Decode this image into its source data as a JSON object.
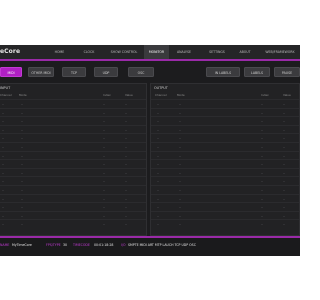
{
  "app": {
    "title": "eCore"
  },
  "nav": {
    "items": [
      {
        "label": "HOME"
      },
      {
        "label": "CLOCK"
      },
      {
        "label": "SHOW CONTROL"
      },
      {
        "label": "MONITOR"
      },
      {
        "label": "ANALYSE"
      },
      {
        "label": "SETTINGS"
      },
      {
        "label": "ABOUT"
      },
      {
        "label": "WEB/FRAMEWORK"
      }
    ],
    "active_index": 3
  },
  "toolbar": {
    "left_buttons": [
      {
        "label": "MIDI"
      },
      {
        "label": "OTHER MIDI"
      },
      {
        "label": "TCP"
      },
      {
        "label": "UDP"
      },
      {
        "label": "OSC"
      }
    ],
    "right_buttons": [
      {
        "label": "IN LABELS"
      },
      {
        "label": "LABELS"
      },
      {
        "label": "PAUSE"
      }
    ]
  },
  "input_panel": {
    "title": "INPUT",
    "columns": [
      "Channel",
      "Mode",
      "Index",
      "Value"
    ],
    "rows": [
      [
        "--",
        "--",
        "--",
        "--"
      ],
      [
        "--",
        "--",
        "--",
        "--"
      ],
      [
        "--",
        "--",
        "--",
        "--"
      ],
      [
        "--",
        "--",
        "--",
        "--"
      ],
      [
        "--",
        "--",
        "--",
        "--"
      ],
      [
        "--",
        "--",
        "--",
        "--"
      ],
      [
        "--",
        "--",
        "--",
        "--"
      ],
      [
        "--",
        "--",
        "--",
        "--"
      ],
      [
        "--",
        "--",
        "--",
        "--"
      ],
      [
        "--",
        "--",
        "--",
        "--"
      ],
      [
        "--",
        "--",
        "--",
        "--"
      ],
      [
        "--",
        "--",
        "--",
        "--"
      ],
      [
        "--",
        "--",
        "--",
        "--"
      ],
      [
        "--",
        "--",
        "--",
        "--"
      ],
      [
        "--",
        "--",
        "--",
        "--"
      ]
    ]
  },
  "output_panel": {
    "title": "OUTPUT",
    "columns": [
      "Channel",
      "Mode",
      "Index",
      "Value"
    ],
    "rows": [
      [
        "--",
        "--",
        "--",
        "--"
      ],
      [
        "--",
        "--",
        "--",
        "--"
      ],
      [
        "--",
        "--",
        "--",
        "--"
      ],
      [
        "--",
        "--",
        "--",
        "--"
      ],
      [
        "--",
        "--",
        "--",
        "--"
      ],
      [
        "--",
        "--",
        "--",
        "--"
      ],
      [
        "--",
        "--",
        "--",
        "--"
      ],
      [
        "--",
        "--",
        "--",
        "--"
      ],
      [
        "--",
        "--",
        "--",
        "--"
      ],
      [
        "--",
        "--",
        "--",
        "--"
      ],
      [
        "--",
        "--",
        "--",
        "--"
      ],
      [
        "--",
        "--",
        "--",
        "--"
      ],
      [
        "--",
        "--",
        "--",
        "--"
      ],
      [
        "--",
        "--",
        "--",
        "--"
      ],
      [
        "--",
        "--",
        "--",
        "--"
      ]
    ]
  },
  "status": {
    "name_label": "NAME",
    "name_value": "MyTimeCore",
    "fps_label": "FPS/TYPE",
    "fps_value": "30",
    "tc_label": "TIMECODE",
    "tc_value": "00:01:18:28",
    "io_label": "I/O",
    "io_value": "SMPTE MIDI ART MTP LAUCH TCP UDP OSC"
  },
  "colors": {
    "accent": "#b020c4",
    "background": "#1c1c1e"
  }
}
